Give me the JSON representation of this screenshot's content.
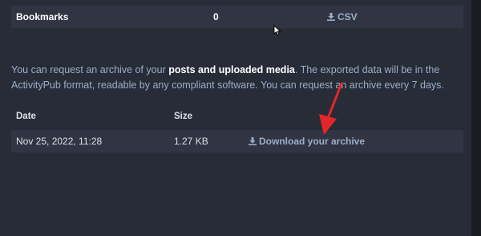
{
  "export": {
    "bookmarks": {
      "label": "Bookmarks",
      "count": "0",
      "csv_label": "CSV"
    }
  },
  "info": {
    "text_before": "You can request an archive of your ",
    "bold": "posts and uploaded media",
    "text_after": ". The exported data will be in the ActivityPub format, readable by any compliant software. You can request an archive every 7 days."
  },
  "archives": {
    "headers": {
      "date": "Date",
      "size": "Size"
    },
    "rows": [
      {
        "date": "Nov 25, 2022, 11:28",
        "size": "1.27 KB",
        "action": "Download your archive"
      }
    ]
  },
  "icons": {
    "download": "download-icon",
    "cursor": "mouse-cursor-icon",
    "annotation": "red-arrow-annotation"
  },
  "colors": {
    "panel": "#282c37",
    "row": "#313543",
    "link": "#9baec8",
    "annotation": "#e3262a"
  }
}
